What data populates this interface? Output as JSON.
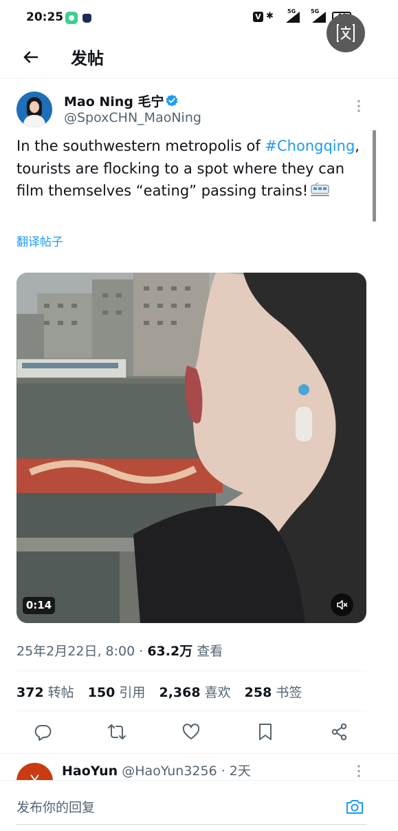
{
  "status_bar": {
    "time": "20:25",
    "network_1": "5G",
    "network_2": "5G",
    "battery": "44"
  },
  "header": {
    "title": "发帖",
    "back_icon": "arrow-left-icon",
    "translate_icon": "translate-icon"
  },
  "tweet": {
    "author_name": "Mao Ning 毛宁",
    "author_handle": "@SpoxCHN_MaoNing",
    "text_before": "In the southwestern metropolis of ",
    "hashtag": "#Chongqing",
    "text_after": ", tourists are flocking to a spot where they can film themselves “eating” passing trains!",
    "emoji": "train-emoji",
    "translate_label": "翻译帖子",
    "video_duration": "0:14",
    "timestamp": "25年2月22日, 8:00",
    "separator": " · ",
    "views_count": "63.2万",
    "views_label": "查看",
    "stats": {
      "retweets": "372",
      "retweets_label": "转帖",
      "quotes": "150",
      "quotes_label": "引用",
      "likes": "2,368",
      "likes_label": "喜欢",
      "bookmarks": "258",
      "bookmarks_label": "书签"
    },
    "actions": [
      "reply-icon",
      "retweet-icon",
      "like-icon",
      "bookmark-icon",
      "share-icon"
    ]
  },
  "reply": {
    "avatar_letter": "Y",
    "name": "HaoYun",
    "handle_time": "@HaoYun3256 · 2天"
  },
  "composer": {
    "placeholder": "发布你的回复"
  },
  "colors": {
    "accent": "#1d9bf0",
    "text_primary": "#0f1419",
    "text_secondary": "#536471"
  }
}
